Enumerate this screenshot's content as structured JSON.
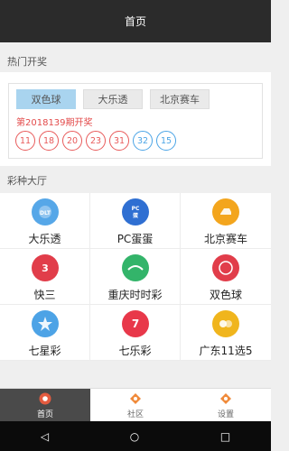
{
  "header": {
    "title": "首页"
  },
  "hot": {
    "section_title": "热门开奖",
    "tabs": [
      "双色球",
      "大乐透",
      "北京赛车"
    ],
    "active_tab": 0,
    "draw_text": "第2018139期开奖",
    "red_balls": [
      "11",
      "18",
      "20",
      "23",
      "31"
    ],
    "blue_balls": [
      "32",
      "15"
    ],
    "colors": {
      "red": "#e85a5a",
      "blue": "#4aa4e6"
    }
  },
  "lottery_hall": {
    "section_title": "彩种大厅",
    "items": [
      {
        "label": "大乐透",
        "icon": "dlt-icon",
        "color": "#56a7e8"
      },
      {
        "label": "PC蛋蛋",
        "icon": "pc-egg-icon",
        "color": "#2f6fd2"
      },
      {
        "label": "北京赛车",
        "icon": "race-car-icon",
        "color": "#f3a51d"
      },
      {
        "label": "快三",
        "icon": "k3-icon",
        "color": "#e13d4a"
      },
      {
        "label": "重庆时时彩",
        "icon": "ssc-icon",
        "color": "#33b46a"
      },
      {
        "label": "双色球",
        "icon": "ssq-icon",
        "color": "#e13d4a"
      },
      {
        "label": "七星彩",
        "icon": "qxc-icon",
        "color": "#4da3e6"
      },
      {
        "label": "七乐彩",
        "icon": "qlc-icon",
        "color": "#e8384a"
      },
      {
        "label": "广东11选5",
        "icon": "gd11x5-icon",
        "color": "#f0b51d"
      }
    ]
  },
  "nav": {
    "items": [
      {
        "label": "首页",
        "icon": "home-icon"
      },
      {
        "label": "社区",
        "icon": "community-icon"
      },
      {
        "label": "设置",
        "icon": "settings-icon"
      }
    ],
    "active": 0
  },
  "system_nav": {
    "back": "◁",
    "home": "○",
    "recents": "□"
  }
}
